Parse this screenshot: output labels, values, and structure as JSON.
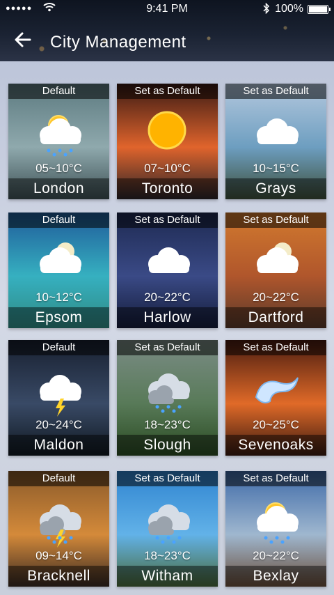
{
  "status": {
    "time": "9:41 PM",
    "battery": "100%",
    "signal": "●●●●●",
    "wifi_icon": "wifi-icon",
    "bluetooth_icon": "bluetooth-icon"
  },
  "header": {
    "title": "City Management",
    "back_icon": "arrow-left-icon"
  },
  "cards": [
    {
      "label": "Default",
      "temp": "05~10°C",
      "city": "London",
      "weather": "sun-cloud-rain",
      "bg": [
        "#5c7a80",
        "#8fa9ad",
        "#3d5054"
      ]
    },
    {
      "label": "Set as Default",
      "temp": "07~10°C",
      "city": "Toronto",
      "weather": "sun",
      "bg": [
        "#3a1a14",
        "#e0642c",
        "#2a2428"
      ]
    },
    {
      "label": "Set as Default",
      "temp": "10~15°C",
      "city": "Grays",
      "weather": "cloud",
      "bg": [
        "#b4c8de",
        "#6d9ec0",
        "#3d4f3a"
      ]
    },
    {
      "label": "Default",
      "temp": "10~12°C",
      "city": "Epsom",
      "weather": "moon-cloud",
      "bg": [
        "#1f5b9a",
        "#36b0c0",
        "#2f8a84"
      ]
    },
    {
      "label": "Set as Default",
      "temp": "20~22°C",
      "city": "Harlow",
      "weather": "cloud",
      "bg": [
        "#1e2a52",
        "#3a4a86",
        "#141c3a"
      ]
    },
    {
      "label": "Set as Default",
      "temp": "20~22°C",
      "city": "Dartford",
      "weather": "moon-cloud",
      "bg": [
        "#d27a2e",
        "#b0562c",
        "#5a3a2a"
      ]
    },
    {
      "label": "Default",
      "temp": "20~24°C",
      "city": "Maldon",
      "weather": "storm",
      "bg": [
        "#182030",
        "#394a66",
        "#101820"
      ]
    },
    {
      "label": "Set as Default",
      "temp": "18~23°C",
      "city": "Slough",
      "weather": "cloud-rain",
      "bg": [
        "#7b8c86",
        "#587a58",
        "#2a4a22"
      ]
    },
    {
      "label": "Set as Default",
      "temp": "20~25°C",
      "city": "Sevenoaks",
      "weather": "wind",
      "bg": [
        "#4a1c10",
        "#e06a28",
        "#3a1a10"
      ]
    },
    {
      "label": "Default",
      "temp": "09~14°C",
      "city": "Bracknell",
      "weather": "storm-cloud",
      "bg": [
        "#8a5a2a",
        "#d48a3a",
        "#3a2a22"
      ]
    },
    {
      "label": "Set as Default",
      "temp": "18~23°C",
      "city": "Witham",
      "weather": "cloud-rain",
      "bg": [
        "#2f84d0",
        "#62b2e8",
        "#4a6a3a"
      ]
    },
    {
      "label": "Set as Default",
      "temp": "20~22°C",
      "city": "Bexlay",
      "weather": "sun-cloud-rain",
      "bg": [
        "#3e6aa8",
        "#9fb7cf",
        "#6a4e3a"
      ]
    }
  ]
}
